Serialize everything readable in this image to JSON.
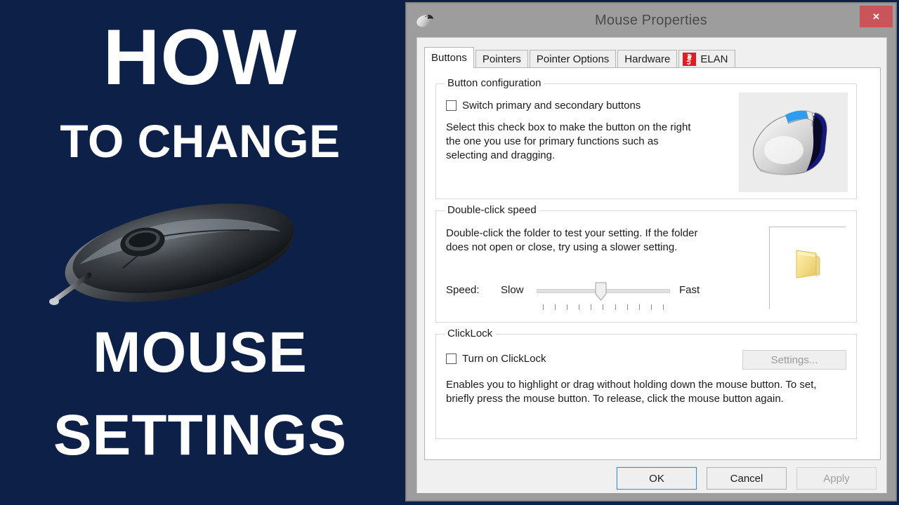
{
  "promo": {
    "line1": "HOW",
    "line2": "TO CHANGE",
    "line3": "MOUSE",
    "line4": "SETTINGS",
    "background_color": "#0d2047",
    "text_color": "#ffffff",
    "mouse_image_alt": "black wired computer mouse"
  },
  "window": {
    "title": "Mouse Properties",
    "icon": "mouse-icon",
    "close_label": "×",
    "titlebar_color": "#9d9d9d",
    "close_button_color": "#c9555a"
  },
  "tabs": [
    {
      "label": "Buttons",
      "active": true
    },
    {
      "label": "Pointers",
      "active": false
    },
    {
      "label": "Pointer Options",
      "active": false
    },
    {
      "label": "Hardware",
      "active": false
    },
    {
      "label": "ELAN",
      "active": false,
      "icon": "elan-logo-icon",
      "icon_color": "#e01d22"
    }
  ],
  "button_configuration": {
    "title": "Button configuration",
    "switch_buttons_label": "Switch primary and secondary buttons",
    "switch_buttons_checked": false,
    "description": "Select this check box to make the button on the right the one you use for primary functions such as selecting and dragging.",
    "preview_alt": "white mouse with blue left button highlighted"
  },
  "double_click_speed": {
    "title": "Double-click speed",
    "description": "Double-click the folder to test your setting. If the folder does not open or close, try using a slower setting.",
    "speed_label": "Speed:",
    "slow_label": "Slow",
    "fast_label": "Fast",
    "slider_value_percent": 50,
    "tick_count": 11,
    "folder_alt": "closed yellow folder"
  },
  "clicklock": {
    "title": "ClickLock",
    "turn_on_label": "Turn on ClickLock",
    "turn_on_checked": false,
    "settings_button_label": "Settings...",
    "settings_button_enabled": false,
    "description": "Enables you to highlight or drag without holding down the mouse button. To set, briefly press the mouse button. To release, click the mouse button again."
  },
  "footer": {
    "ok_label": "OK",
    "cancel_label": "Cancel",
    "apply_label": "Apply",
    "apply_enabled": false,
    "focus_color": "#3c93d8"
  }
}
